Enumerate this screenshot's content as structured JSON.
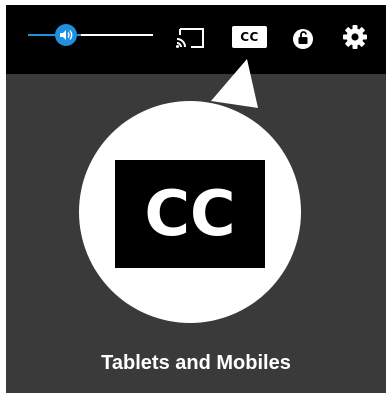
{
  "player": {
    "volume_fraction": 0.42,
    "colors": {
      "accent": "#1f8fe0",
      "toolbar": "#000000",
      "background": "#3a3a3a",
      "bubble": "#ffffff"
    },
    "toolbar": {
      "icons": [
        "volume-icon",
        "cast-icon",
        "cc-icon",
        "lock-icon",
        "gear-icon"
      ],
      "cc_label": "CC"
    }
  },
  "illustration": {
    "cc_label": "CC",
    "caption": "Tablets and Mobiles"
  }
}
